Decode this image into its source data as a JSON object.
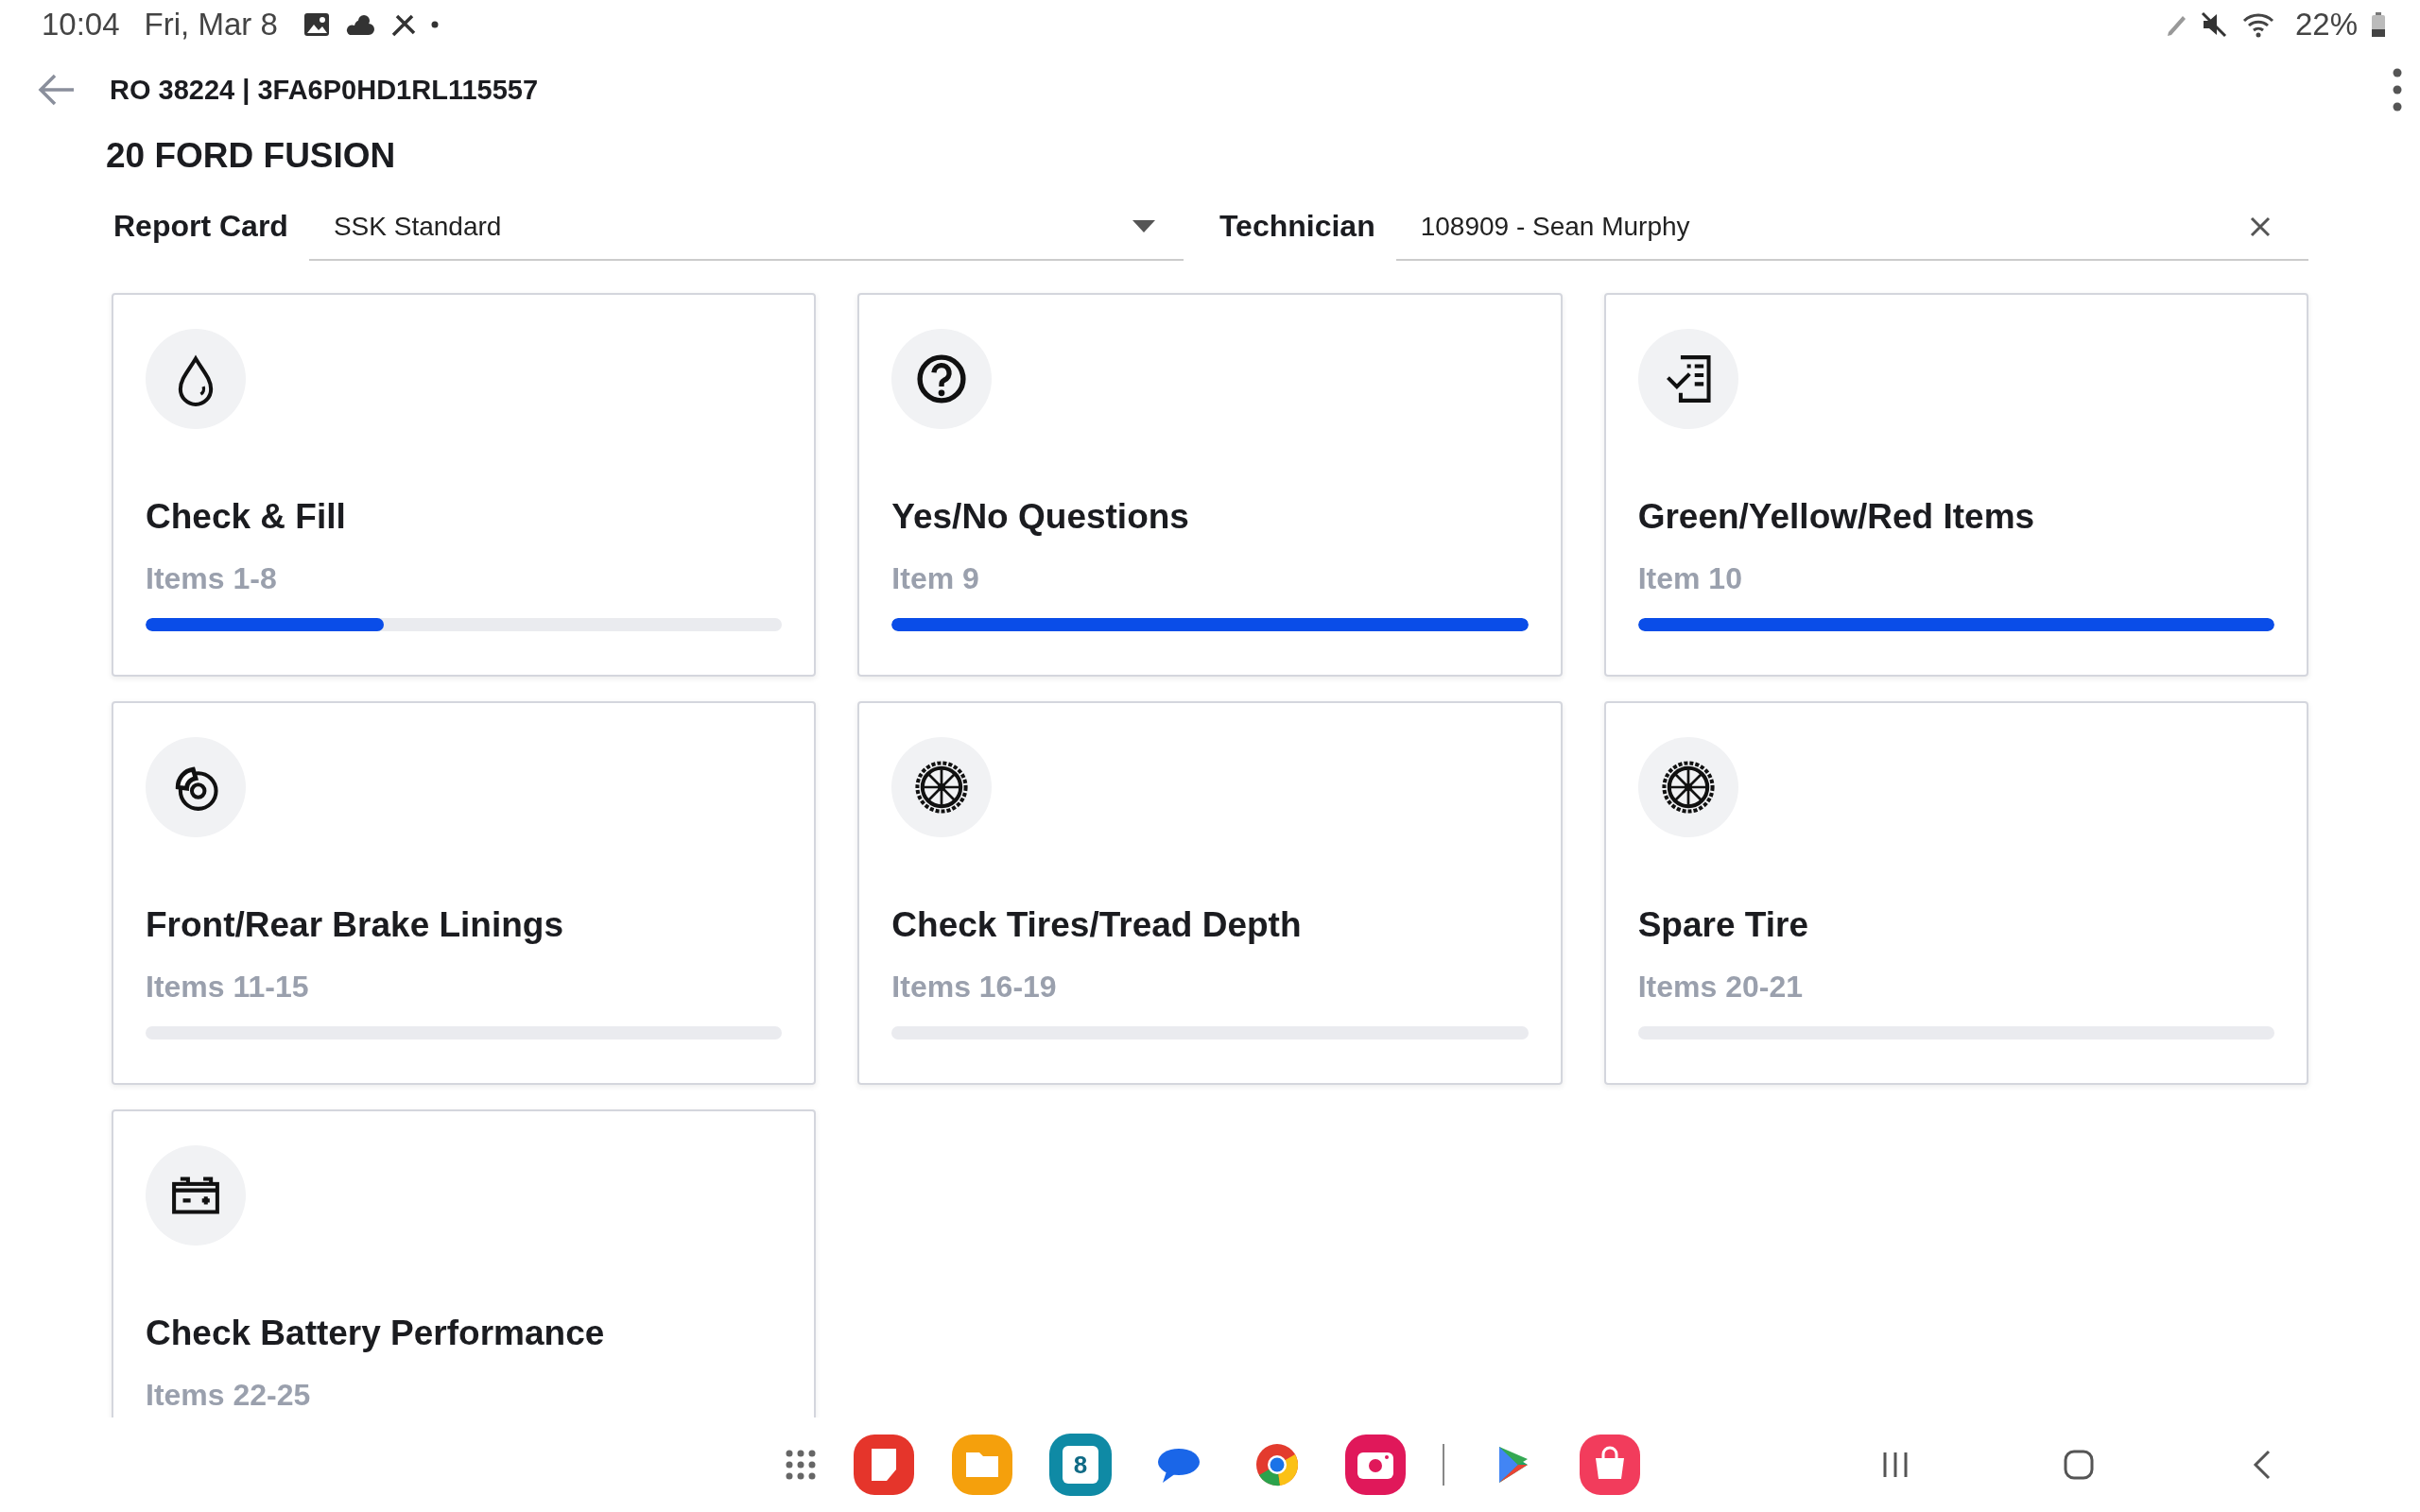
{
  "status_bar": {
    "time": "10:04",
    "date": "Fri, Mar 8",
    "battery": "22%"
  },
  "app_bar": {
    "title": "RO 38224 | 3FA6P0HD1RL115557"
  },
  "vehicle": "20 FORD FUSION",
  "filters": {
    "report_card": {
      "label": "Report Card",
      "value": "SSK Standard"
    },
    "technician": {
      "label": "Technician",
      "value": "108909 - Sean Murphy"
    }
  },
  "cards": [
    {
      "title": "Check & Fill",
      "items": "Items 1-8",
      "level": 0.375
    },
    {
      "title": "Yes/No Questions",
      "items": "Item 9",
      "level": 1
    },
    {
      "title": "Green/Yellow/Red Items",
      "items": "Item 10",
      "level": 1
    },
    {
      "title": "Front/Rear Brake Linings",
      "items": "Items 11-15",
      "level": 0
    },
    {
      "title": "Check Tires/Tread Depth",
      "items": "Items 16-19",
      "level": 0
    },
    {
      "title": "Spare Tire",
      "items": "Items 20-21",
      "level": 0
    },
    {
      "title": "Check Battery Performance",
      "items": "Items 22-25"
    }
  ],
  "dock": {
    "calendar_date": "8"
  }
}
